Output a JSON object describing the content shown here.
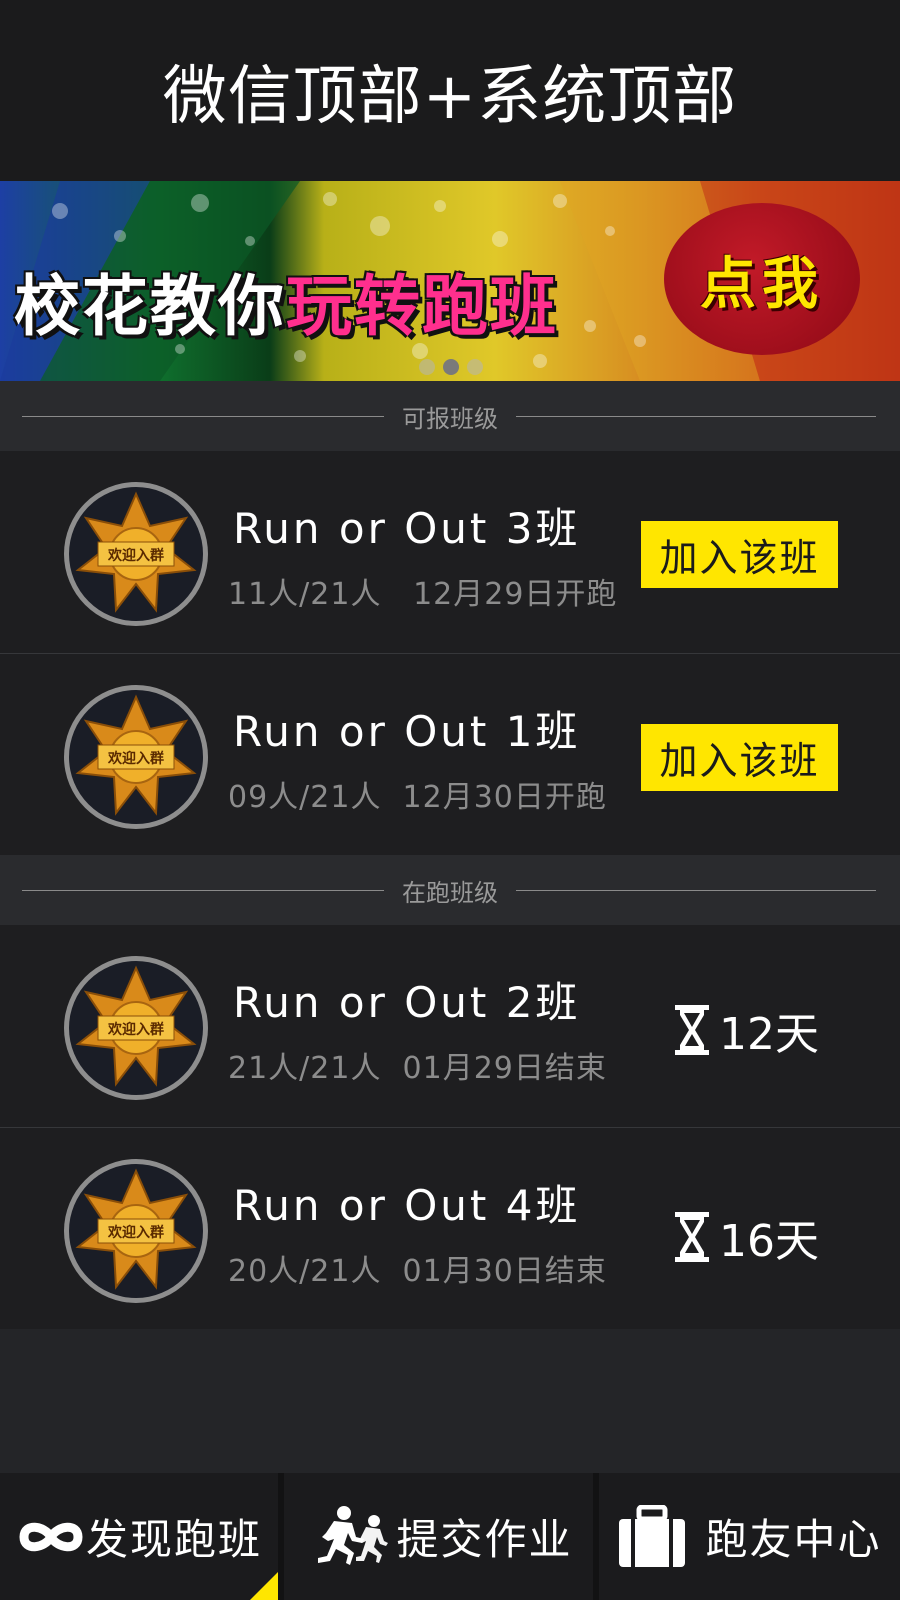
{
  "header": {
    "title": "微信顶部+系统顶部"
  },
  "banner": {
    "headline_white": "校花教你",
    "headline_pink": "玩转跑班",
    "cta": "点我",
    "carousel_dots": 3,
    "active_dot": 2
  },
  "sections": {
    "open_label": "可报班级",
    "running_label": "在跑班级"
  },
  "open_classes": [
    {
      "name": "Run or Out 3班",
      "members": "11人/21人",
      "date": "12月29日开跑",
      "action": "加入该班",
      "badge_text": "欢迎入群"
    },
    {
      "name": "Run or Out 1班",
      "members": "09人/21人",
      "date": "12月30日开跑",
      "action": "加入该班",
      "badge_text": "欢迎入群"
    }
  ],
  "running_classes": [
    {
      "name": "Run or Out 2班",
      "members": "21人/21人",
      "date": "01月29日结束",
      "days_left": "12天",
      "badge_text": "欢迎入群"
    },
    {
      "name": "Run or Out 4班",
      "members": "20人/21人",
      "date": "01月30日结束",
      "days_left": "16天",
      "badge_text": "欢迎入群"
    }
  ],
  "tabbar": {
    "items": [
      {
        "label": "发现跑班",
        "icon": "infinity-icon",
        "active": true
      },
      {
        "label": "提交作业",
        "icon": "runners-icon",
        "active": false
      },
      {
        "label": "跑友中心",
        "icon": "briefcase-icon",
        "active": false
      }
    ]
  },
  "colors": {
    "accent": "#ffe600",
    "background": "#1e1e20",
    "banner_cta": "#9a0d1a",
    "headline_pink": "#ff2f8e"
  }
}
